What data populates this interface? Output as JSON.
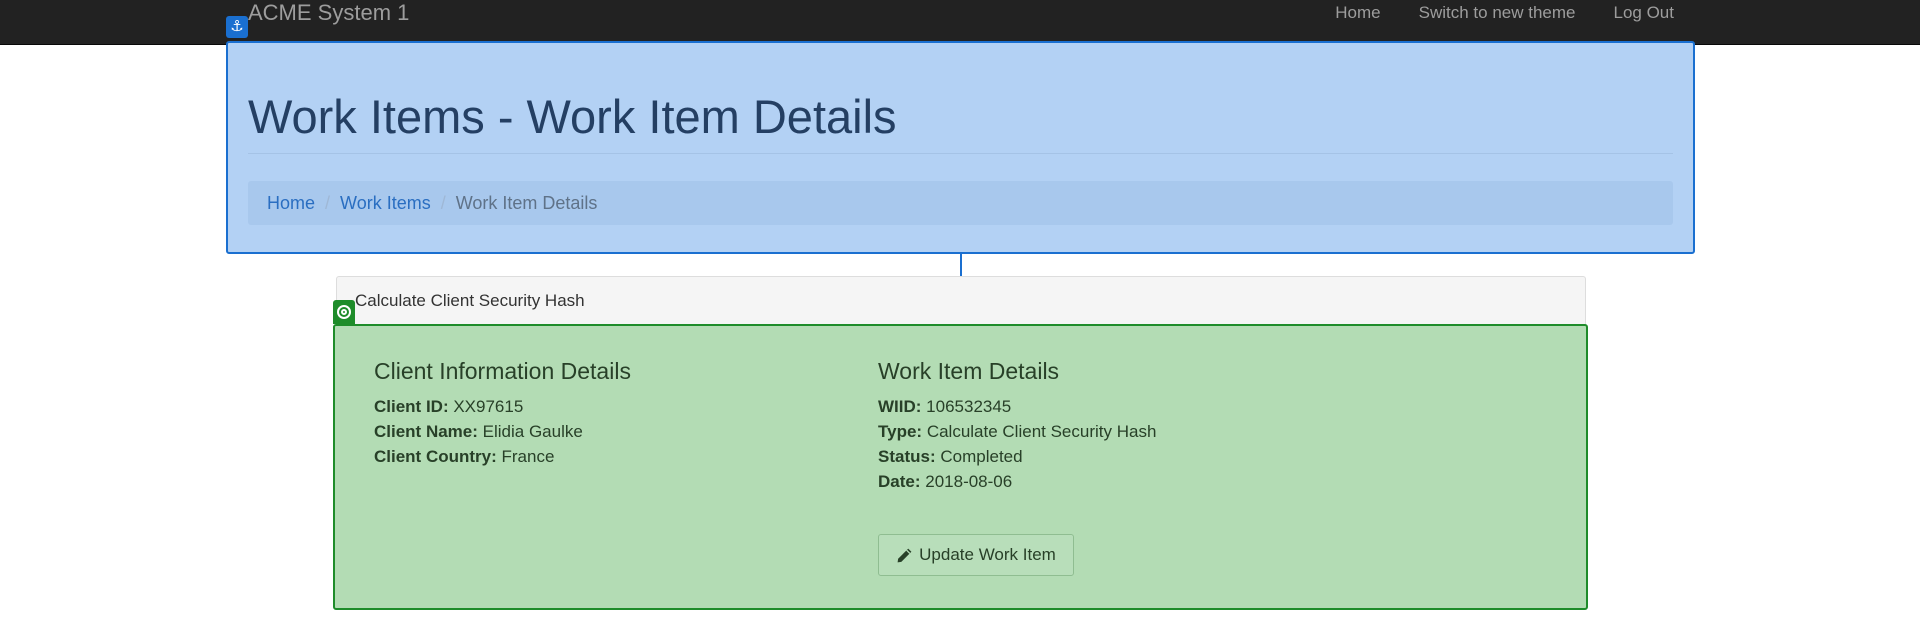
{
  "navbar": {
    "brand": "ACME System 1",
    "links": [
      {
        "label": "Home"
      },
      {
        "label": "Switch to new theme"
      },
      {
        "label": "Log Out"
      }
    ]
  },
  "header": {
    "title": "Work Items - Work Item Details",
    "breadcrumb": {
      "items": [
        {
          "label": "Home"
        },
        {
          "label": "Work Items"
        }
      ],
      "separator": "/",
      "active": "Work Item Details"
    }
  },
  "panel": {
    "heading": "Calculate Client Security Hash",
    "client_section": {
      "title": "Client Information Details",
      "fields": [
        {
          "label": "Client ID:",
          "value": "XX97615"
        },
        {
          "label": "Client Name:",
          "value": "Elidia Gaulke"
        },
        {
          "label": "Client Country:",
          "value": "France"
        }
      ]
    },
    "work_item_section": {
      "title": "Work Item Details",
      "fields": [
        {
          "label": "WIID:",
          "value": "106532345"
        },
        {
          "label": "Type:",
          "value": "Calculate Client Security Hash"
        },
        {
          "label": "Status:",
          "value": "Completed"
        },
        {
          "label": "Date:",
          "value": "2018-08-06"
        }
      ]
    },
    "update_button": {
      "label": "Update Work Item",
      "icon": "pencil-icon"
    }
  },
  "overlay": {
    "anchor_icon": "anchor-icon",
    "target_icon": "target-icon",
    "anchor_color": "#1a6fd0",
    "target_color": "#1e8c2a"
  }
}
